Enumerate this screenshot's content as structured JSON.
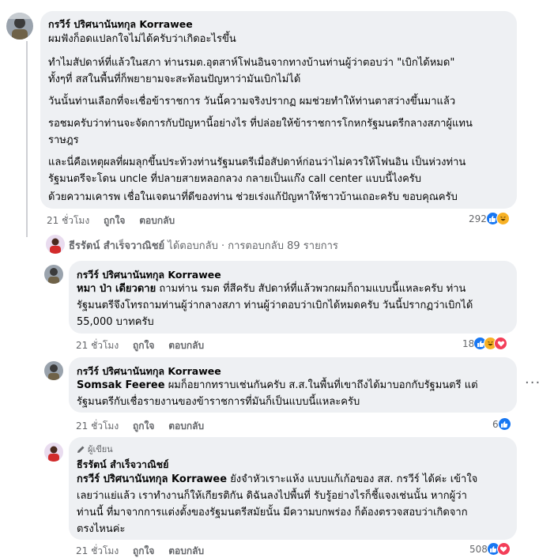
{
  "main_comment": {
    "author": "กรวีร์ ปริศนานันทกุล Korrawee",
    "paragraphs": [
      "ผมฟังก็อดแปลกใจไม่ได้ครับว่าเกิดอะไรขึ้น",
      "ทำไมสัปดาห์ที่แล้วในสภา ท่านรมต.อุตสาห์โฟนอินจากทางบ้านท่านผู้ว่าตอบว่า \"เบิกได้หมด\"",
      "ทั้งๆที่ สสในพื้นที่ก็พยายามจะสะท้อนปัญหาว่ามันเบิกไม่ได้",
      "วันนั้นท่านเลือกที่จะเชื่อข้าราชการ วันนี้ความจริงปรากฏ ผมช่วยทำให้ท่านตาสว่างขึ้นมาแล้ว",
      "รอชมครับว่าท่านจะจัดการกับปัญหานี้อย่างไร ที่ปล่อยให้ข้าราชการโกหกรัฐมนตรีกลางสภาผู้แทน",
      "ราษฎร",
      "และนี่คือเหตุผลที่ผมลุกขึ้นประท้วงท่านรัฐมนตรีเมื่อสัปดาห์ก่อนว่าไม่ควรให้โฟนอิน เป็นห่วงท่าน",
      "รัฐมนตรีจะโดน uncle ที่ปลายสายหลอกลวง กลายเป็นแก๊ง call center แบบนี้ไงครับ",
      "ด้วยความเคารพ เชื่อในเจตนาที่ดีของท่าน ช่วยเร่งแก้ปัญหาให้ชาวบ้านเถอะครับ ขอบคุณครับ"
    ],
    "time": "21 ชั่วโมง",
    "like_label": "ถูกใจ",
    "reply_label": "ตอบกลับ",
    "reaction_count": "292"
  },
  "reply_summary": {
    "name": "ธีรรัตน์ สำเร็จวาณิชย์",
    "text": "ได้ตอบกลับ · การตอบกลับ 89 รายการ"
  },
  "replies": [
    {
      "author": "กรวีร์ ปริศนานันทกุล Korrawee",
      "mention": "หมา ป่า เดียวดาย",
      "lines": [
        " ถามท่าน รมต ที่สีครับ สัปดาห์ที่แล้วพวกผมก็ถามแบบนี้แหละครับ ท่าน",
        "รัฐมนตรีจึงโทรถามท่านผู้ว่ากลางสภา ท่านผู้ว่าตอบว่าเบิกได้หมดครับ วันนี้ปรากฏว่าเบิกได้",
        "55,000 บาทครับ"
      ],
      "time": "21 ชั่วโมง",
      "like_label": "ถูกใจ",
      "reply_label": "ตอบกลับ",
      "reaction_count": "18"
    },
    {
      "author": "กรวีร์ ปริศนานันทกุล Korrawee",
      "mention": "Somsak Feeree",
      "lines": [
        " ผมก็อยากทราบเช่นกันครับ ส.ส.ในพื้นที่เขาถึงได้มาบอกกับรัฐมนตรี แต่",
        "รัฐมนตรีกับเชื่อรายงานของข้าราชการที่มันก็เป็นแบบนี้แหละครับ"
      ],
      "more_label": "···",
      "time": "21 ชั่วโมง",
      "like_label": "ถูกใจ",
      "reply_label": "ตอบกลับ",
      "reaction_count": "6"
    },
    {
      "author_tag": "ผู้เขียน",
      "author": "ธีรรัตน์ สำเร็จวาณิชย์",
      "mention": "กรวีร์ ปริศนานันทกุล Korrawee",
      "lines": [
        " ยังจำหัวเราะแห้ง แบบแก้เก้อของ สส. กรวีร์ ได้ค่ะ เข้าใจ",
        "เลยว่าแย่แล้ว เราทำงานก็ให้เกียรติกัน ดิฉันลงไปพื้นที่ รับรู้อย่างไรก็ชี้แจงเช่นนั้น หากผู้ว่า",
        "ท่านนี้ ที่มาจากการแต่งตั้งของรัฐมนตรีสมัยนั้น มีความบกพร่อง ก็ต้องตรวจสอบว่าเกิดจาก",
        "ตรงไหนค่ะ"
      ],
      "time": "21 ชั่วโมง",
      "like_label": "ถูกใจ",
      "reply_label": "ตอบกลับ",
      "reaction_count": "508"
    }
  ]
}
